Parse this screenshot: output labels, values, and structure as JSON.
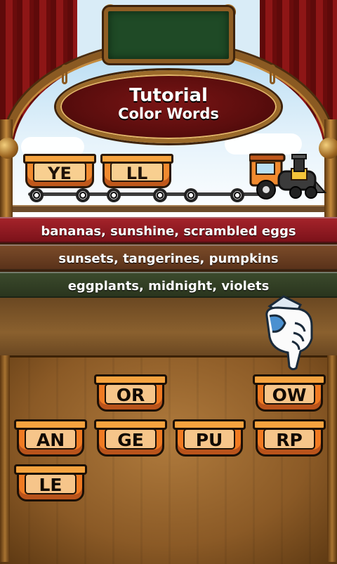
{
  "header": {
    "title": "Tutorial",
    "subtitle": "Color Words"
  },
  "train": {
    "cars": [
      "YE",
      "LL"
    ]
  },
  "clues": [
    "bananas, sunshine, scrambled eggs",
    "sunsets, tangerines, pumpkins",
    "eggplants, midnight, violets"
  ],
  "tiles": [
    "OR",
    "OW",
    "AN",
    "GE",
    "PU",
    "RP",
    "LE"
  ],
  "colors": {
    "clue_row_1": "#8e1b22",
    "clue_row_2": "#6a3f22",
    "clue_row_3": "#333f25",
    "tile_orange": "#f07a22",
    "tile_face": "#f6c58a"
  },
  "icons": {
    "pointer": "pointing-hand-icon",
    "engine": "locomotive-icon"
  }
}
